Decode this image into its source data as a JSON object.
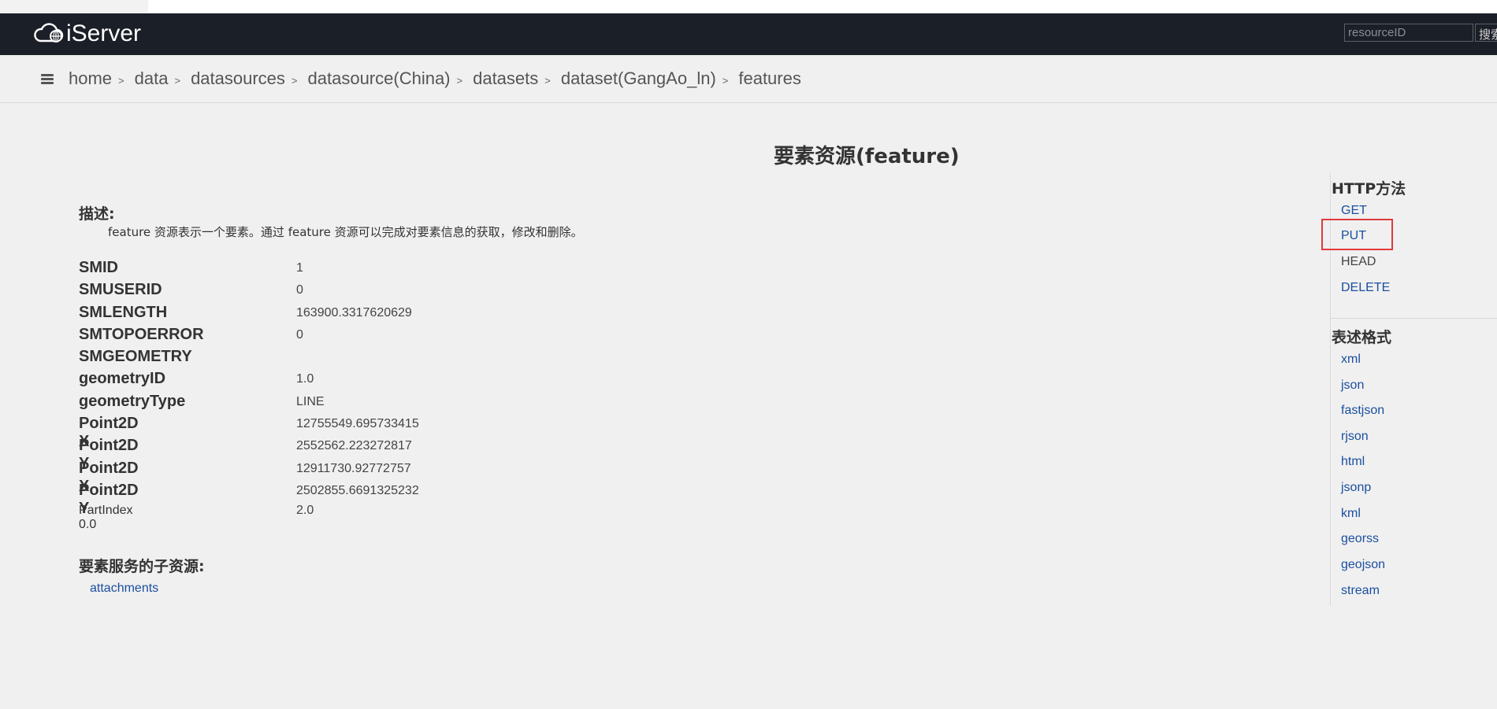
{
  "header": {
    "logo_text": "iServer",
    "search_placeholder": "resourceID",
    "search_button": "搜索"
  },
  "breadcrumb": [
    {
      "label": "home"
    },
    {
      "label": "data"
    },
    {
      "label": "datasources"
    },
    {
      "label": "datasource(China)"
    },
    {
      "label": "datasets"
    },
    {
      "label": "dataset(GangAo_ln)"
    },
    {
      "label": "features"
    }
  ],
  "breadcrumb_separator": ">",
  "main": {
    "title": "要素资源(feature)",
    "description_label": "描述:",
    "description_text": "feature 资源表示一个要素。通过 feature 资源可以完成对要素信息的获取，修改和删除。",
    "fields": [
      {
        "name": "SMID",
        "value": "1"
      },
      {
        "name": "SMUSERID",
        "value": "0"
      },
      {
        "name": "SMLENGTH",
        "value": "163900.3317620629"
      },
      {
        "name": "SMTOPOERROR",
        "value": "0"
      },
      {
        "name": "SMGEOMETRY",
        "value": ""
      },
      {
        "name": "geometryID",
        "value": "1.0"
      },
      {
        "name": "geometryType",
        "value": "LINE"
      },
      {
        "name": "Point2D X",
        "value": "12755549.695733415"
      },
      {
        "name": "Point2D Y",
        "value": "2552562.223272817"
      },
      {
        "name": "Point2D X",
        "value": "12911730.92772757"
      },
      {
        "name": "Point2D Y",
        "value": "2502855.6691325232"
      },
      {
        "name": "PartIndex 0.0",
        "value": "2.0"
      }
    ],
    "subresources_label": "要素服务的子资源:",
    "subresources": [
      "attachments"
    ]
  },
  "sidebar": {
    "http_methods_heading": "HTTP方法",
    "http_methods": [
      "GET",
      "PUT",
      "HEAD",
      "DELETE"
    ],
    "formats_heading": "表述格式",
    "formats": [
      "xml",
      "json",
      "fastjson",
      "rjson",
      "html",
      "jsonp",
      "kml",
      "georss",
      "geojson",
      "stream"
    ]
  },
  "colors": {
    "header_bg": "#1b1f27",
    "link": "#1a4fa0",
    "highlight": "#e0393c",
    "page_bg": "#f0f0f0"
  }
}
